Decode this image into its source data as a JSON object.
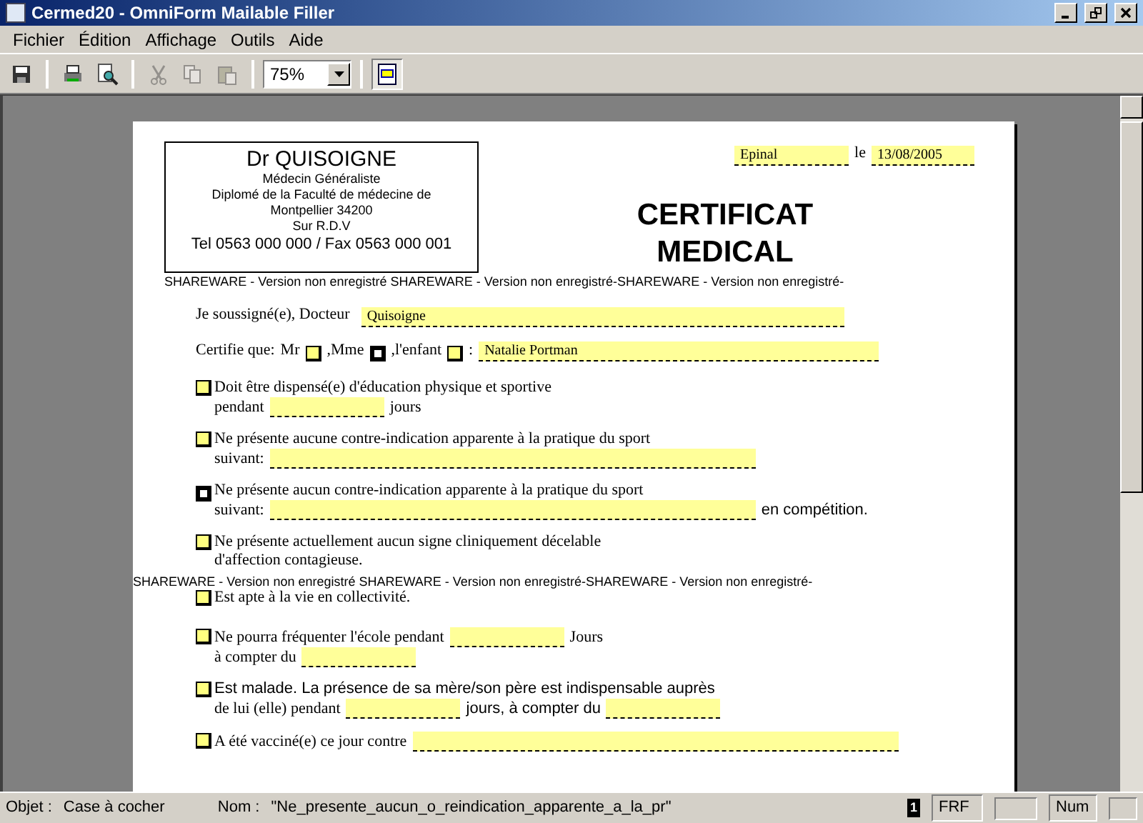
{
  "window": {
    "title": "Cermed20 - OmniForm Mailable Filler"
  },
  "menu": [
    "Fichier",
    "Édition",
    "Affichage",
    "Outils",
    "Aide"
  ],
  "toolbar": {
    "zoom": "75%",
    "page_view_selected": true
  },
  "document": {
    "header_box": [
      "Dr QUISOIGNE",
      "Médecin Généraliste",
      "Diplomé de la Faculté de médecine de",
      "Montpellier 34200",
      "Sur R.D.V",
      "Tel 0563 000 000 / Fax 0563 000 001"
    ],
    "place": "Epinal",
    "date_prefix": "le",
    "date": "13/08/2005",
    "title": [
      "CERTIFICAT",
      "MEDICAL"
    ],
    "shareware_note": "SHAREWARE - Version non enregistré SHAREWARE - Version non enregistré-SHAREWARE - Version non enregistré-",
    "doctor": {
      "label": "Je soussigné(e), Docteur",
      "value": "Quisoigne"
    },
    "certify": {
      "label": "Certifie que:",
      "options": [
        {
          "label": "Mr",
          "checked": false
        },
        {
          "label": ",Mme",
          "checked": true
        },
        {
          "label": ",l'enfant",
          "checked": false
        }
      ],
      "suffix": ":",
      "value": "Natalie Portman"
    },
    "items": [
      {
        "checked": false,
        "lines": [
          [
            {
              "kind": "text",
              "text": "Doit être dispensé(e) d'éducation physique et sportive"
            }
          ],
          [
            {
              "kind": "text",
              "text": "pendant"
            },
            {
              "kind": "short"
            },
            {
              "kind": "text",
              "text": "jours"
            }
          ]
        ]
      },
      {
        "checked": false,
        "lines": [
          [
            {
              "kind": "text",
              "text": "Ne présente aucune contre-indication apparente à la pratique du sport"
            }
          ],
          [
            {
              "kind": "text",
              "text": "suivant:"
            },
            {
              "kind": "long"
            }
          ]
        ]
      },
      {
        "checked": true,
        "lines": [
          [
            {
              "kind": "text",
              "text": "Ne présente aucun contre-indication apparente à la pratique du sport"
            }
          ],
          [
            {
              "kind": "text",
              "text": "suivant:"
            },
            {
              "kind": "long"
            },
            {
              "kind": "sans",
              "text": "en compétition."
            }
          ]
        ]
      },
      {
        "checked": false,
        "lines": [
          [
            {
              "kind": "text",
              "text": "Ne présente actuellement aucun signe cliniquement décelable"
            }
          ],
          [
            {
              "kind": "text",
              "text": "d'affection contagieuse."
            }
          ]
        ]
      },
      {
        "kind": "note",
        "text": "SHAREWARE - Version non enregistré SHAREWARE - Version non enregistré-SHAREWARE - Version non enregistré-"
      },
      {
        "checked": false,
        "lines": [
          [
            {
              "kind": "text",
              "text": "Est apte à la vie en collectivité."
            }
          ]
        ]
      },
      {
        "checked": false,
        "lines": [
          [
            {
              "kind": "text",
              "text": "Ne pourra fréquenter l'école pendant"
            },
            {
              "kind": "short"
            },
            {
              "kind": "text",
              "text": "Jours"
            }
          ],
          [
            {
              "kind": "text",
              "text": "à compter du"
            },
            {
              "kind": "short"
            }
          ]
        ]
      },
      {
        "checked": false,
        "lines": [
          [
            {
              "kind": "sans",
              "text": "Est malade. La présence de sa mère/son père est indispensable auprès"
            }
          ],
          [
            {
              "kind": "text",
              "text": "de lui (elle) pendant"
            },
            {
              "kind": "short"
            },
            {
              "kind": "sans",
              "text": "jours, à compter du"
            },
            {
              "kind": "short"
            }
          ]
        ]
      },
      {
        "checked": false,
        "lines": [
          [
            {
              "kind": "text",
              "text": "A été vacciné(e) ce jour contre"
            },
            {
              "kind": "long"
            }
          ]
        ]
      }
    ]
  },
  "status_bar": {
    "object_label": "Objet :",
    "object_value": "Case à cocher",
    "name_label": "Nom :",
    "name_value": "\"Ne_presente_aucun_o_reindication_apparente_a_la_pr\"",
    "page": "1",
    "currency": "FRF",
    "numlock": "Num"
  }
}
